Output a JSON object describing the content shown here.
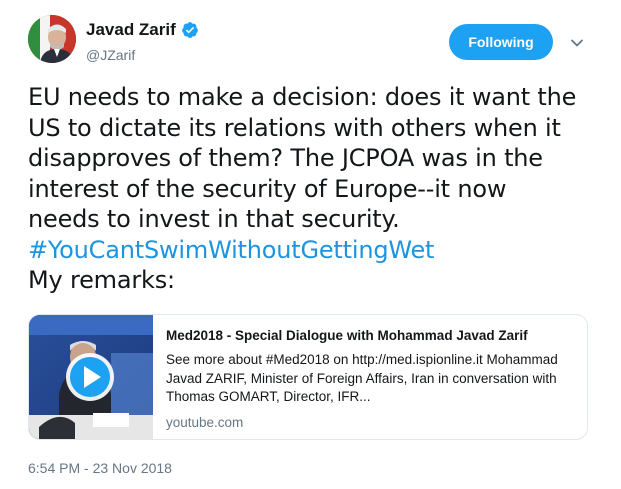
{
  "author": {
    "display_name": "Javad Zarif",
    "handle": "@JZarif",
    "verified": true
  },
  "follow_button": {
    "label": "Following"
  },
  "icons": {
    "verified": "verified-badge-icon",
    "menu": "chevron-down-icon",
    "play": "play-icon"
  },
  "tweet": {
    "lines": [
      "EU needs to make a decision: does it want the",
      "US to dictate its relations with others when it",
      "disapproves of them? The JCPOA was in the",
      "interest of the security of Europe--it now",
      "needs to invest in that security."
    ],
    "hashtag": "#YouCantSwimWithoutGettingWet",
    "closing": "My remarks:"
  },
  "card": {
    "title": "Med2018 - Special Dialogue with Mohammad Javad Zarif",
    "description_lines": [
      "See more about #Med2018 on http://med.ispionline.it Mohammad",
      "Javad ZARIF, Minister of Foreign Affairs, Iran in conversation with",
      "Thomas GOMART, Director, IFR..."
    ],
    "domain": "youtube.com"
  },
  "timestamp": "6:54 PM - 23 Nov 2018",
  "colors": {
    "accent": "#1da1f2",
    "link": "#1b95e0",
    "secondary_text": "#657786",
    "border": "#e1e8ed"
  }
}
